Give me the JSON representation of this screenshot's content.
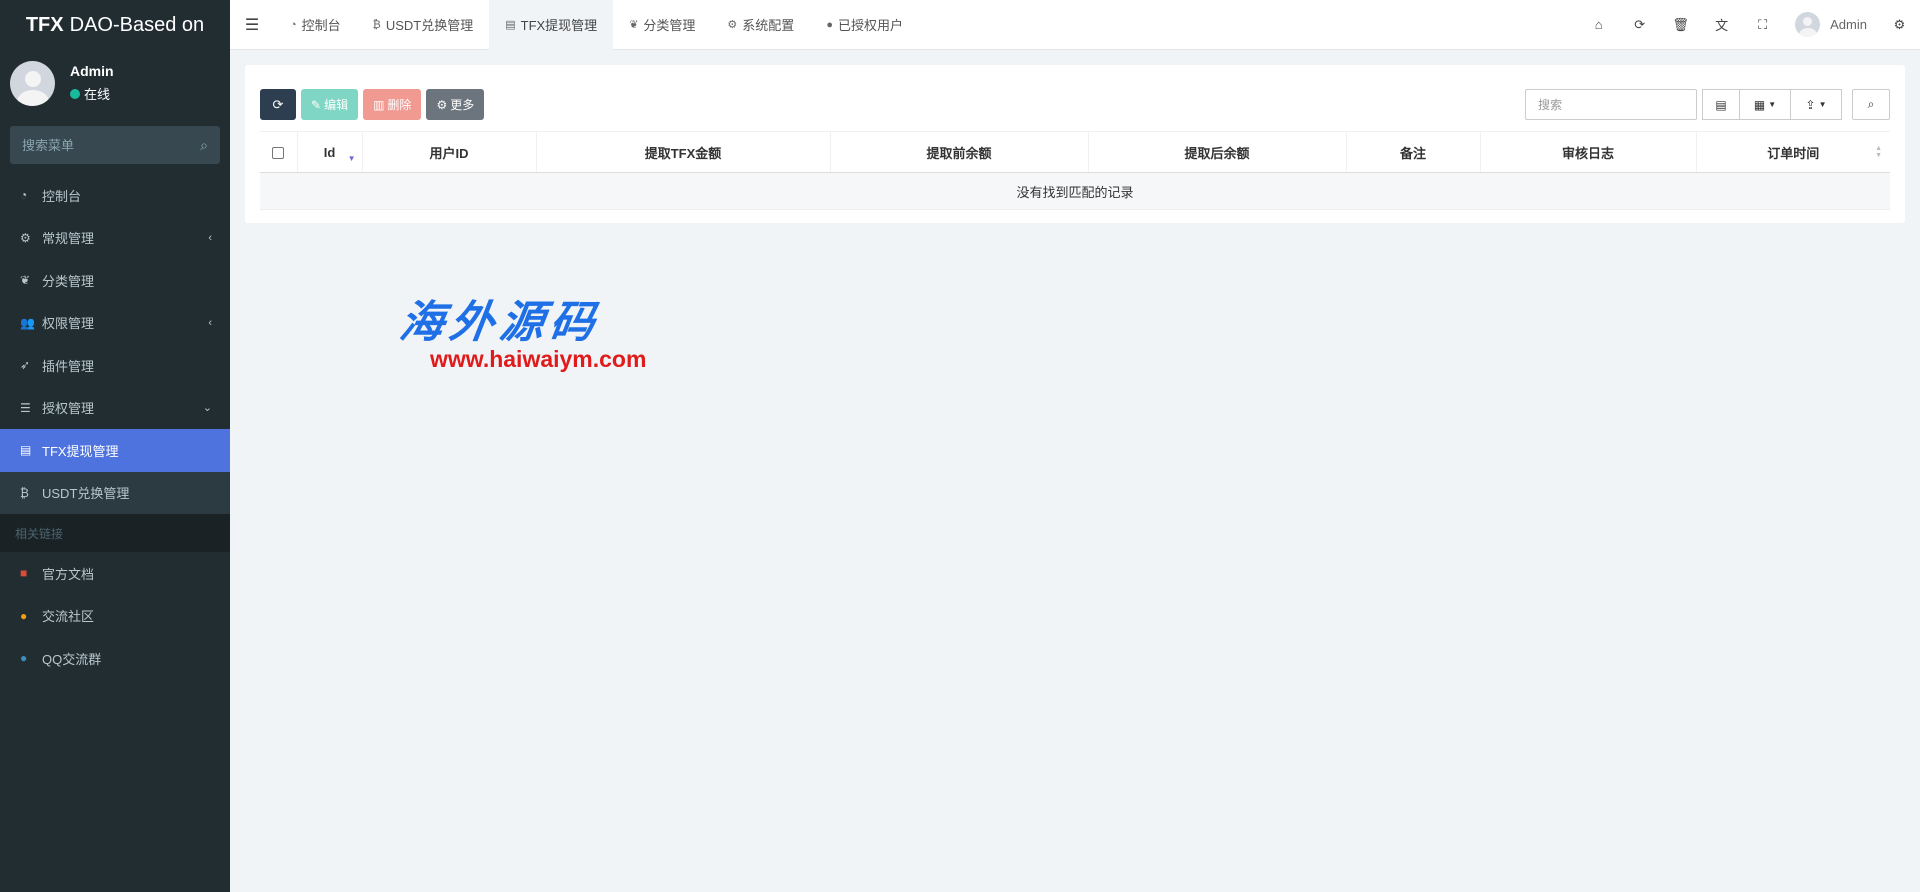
{
  "sidebar": {
    "logo_bold": "TFX",
    "logo_rest": "DAO-Based on",
    "user_name": "Admin",
    "user_status": "在线",
    "search_placeholder": "搜索菜单",
    "items": [
      {
        "label": "控制台",
        "icon": "dashboard-icon",
        "glyph": "◔"
      },
      {
        "label": "常规管理",
        "icon": "cogs-icon",
        "glyph": "⚙",
        "arrow": "‹"
      },
      {
        "label": "分类管理",
        "icon": "leaf-icon",
        "glyph": "❦"
      },
      {
        "label": "权限管理",
        "icon": "group-icon",
        "glyph": "👥",
        "arrow": "‹"
      },
      {
        "label": "插件管理",
        "icon": "rocket-icon",
        "glyph": "➶"
      },
      {
        "label": "授权管理",
        "icon": "list-icon",
        "glyph": "☰",
        "arrow": "⌄"
      },
      {
        "label": "TFX提现管理",
        "icon": "id-card-icon",
        "glyph": "▤"
      },
      {
        "label": "USDT兑换管理",
        "icon": "bitcoin-icon",
        "glyph": "₿"
      }
    ],
    "section_header": "相关链接",
    "links": [
      {
        "label": "官方文档",
        "icon": "doc-icon",
        "glyph": "■",
        "color": "#dd4b39"
      },
      {
        "label": "交流社区",
        "icon": "comment-icon",
        "glyph": "●",
        "color": "#f39c12"
      },
      {
        "label": "QQ交流群",
        "icon": "qq-icon",
        "glyph": "●",
        "color": "#3c8dbc"
      }
    ]
  },
  "navbar": {
    "tabs": [
      {
        "label": "控制台",
        "icon": "dashboard-icon",
        "glyph": "◔"
      },
      {
        "label": "USDT兑换管理",
        "icon": "bitcoin-icon",
        "glyph": "₿"
      },
      {
        "label": "TFX提现管理",
        "icon": "id-card-icon",
        "glyph": "▤"
      },
      {
        "label": "分类管理",
        "icon": "leaf-icon",
        "glyph": "❦"
      },
      {
        "label": "系统配置",
        "icon": "cog-icon",
        "glyph": "⚙"
      },
      {
        "label": "已授权用户",
        "icon": "user-icon",
        "glyph": "●"
      }
    ],
    "user_name": "Admin"
  },
  "toolbar": {
    "edit_label": "编辑",
    "delete_label": "删除",
    "more_label": "更多",
    "search_placeholder": "搜索"
  },
  "table": {
    "columns": [
      "Id",
      "用户ID",
      "提取TFX金额",
      "提取前余额",
      "提取后余额",
      "备注",
      "审核日志",
      "订单时间"
    ],
    "empty_text": "没有找到匹配的记录"
  },
  "watermark": {
    "title": "海外源码",
    "url": "www.haiwaiym.com"
  },
  "colors": {
    "sidebar_bg": "#222d32",
    "active_item": "#4e73df",
    "edit_btn": "#7fd6c4",
    "delete_btn": "#f09a92"
  }
}
